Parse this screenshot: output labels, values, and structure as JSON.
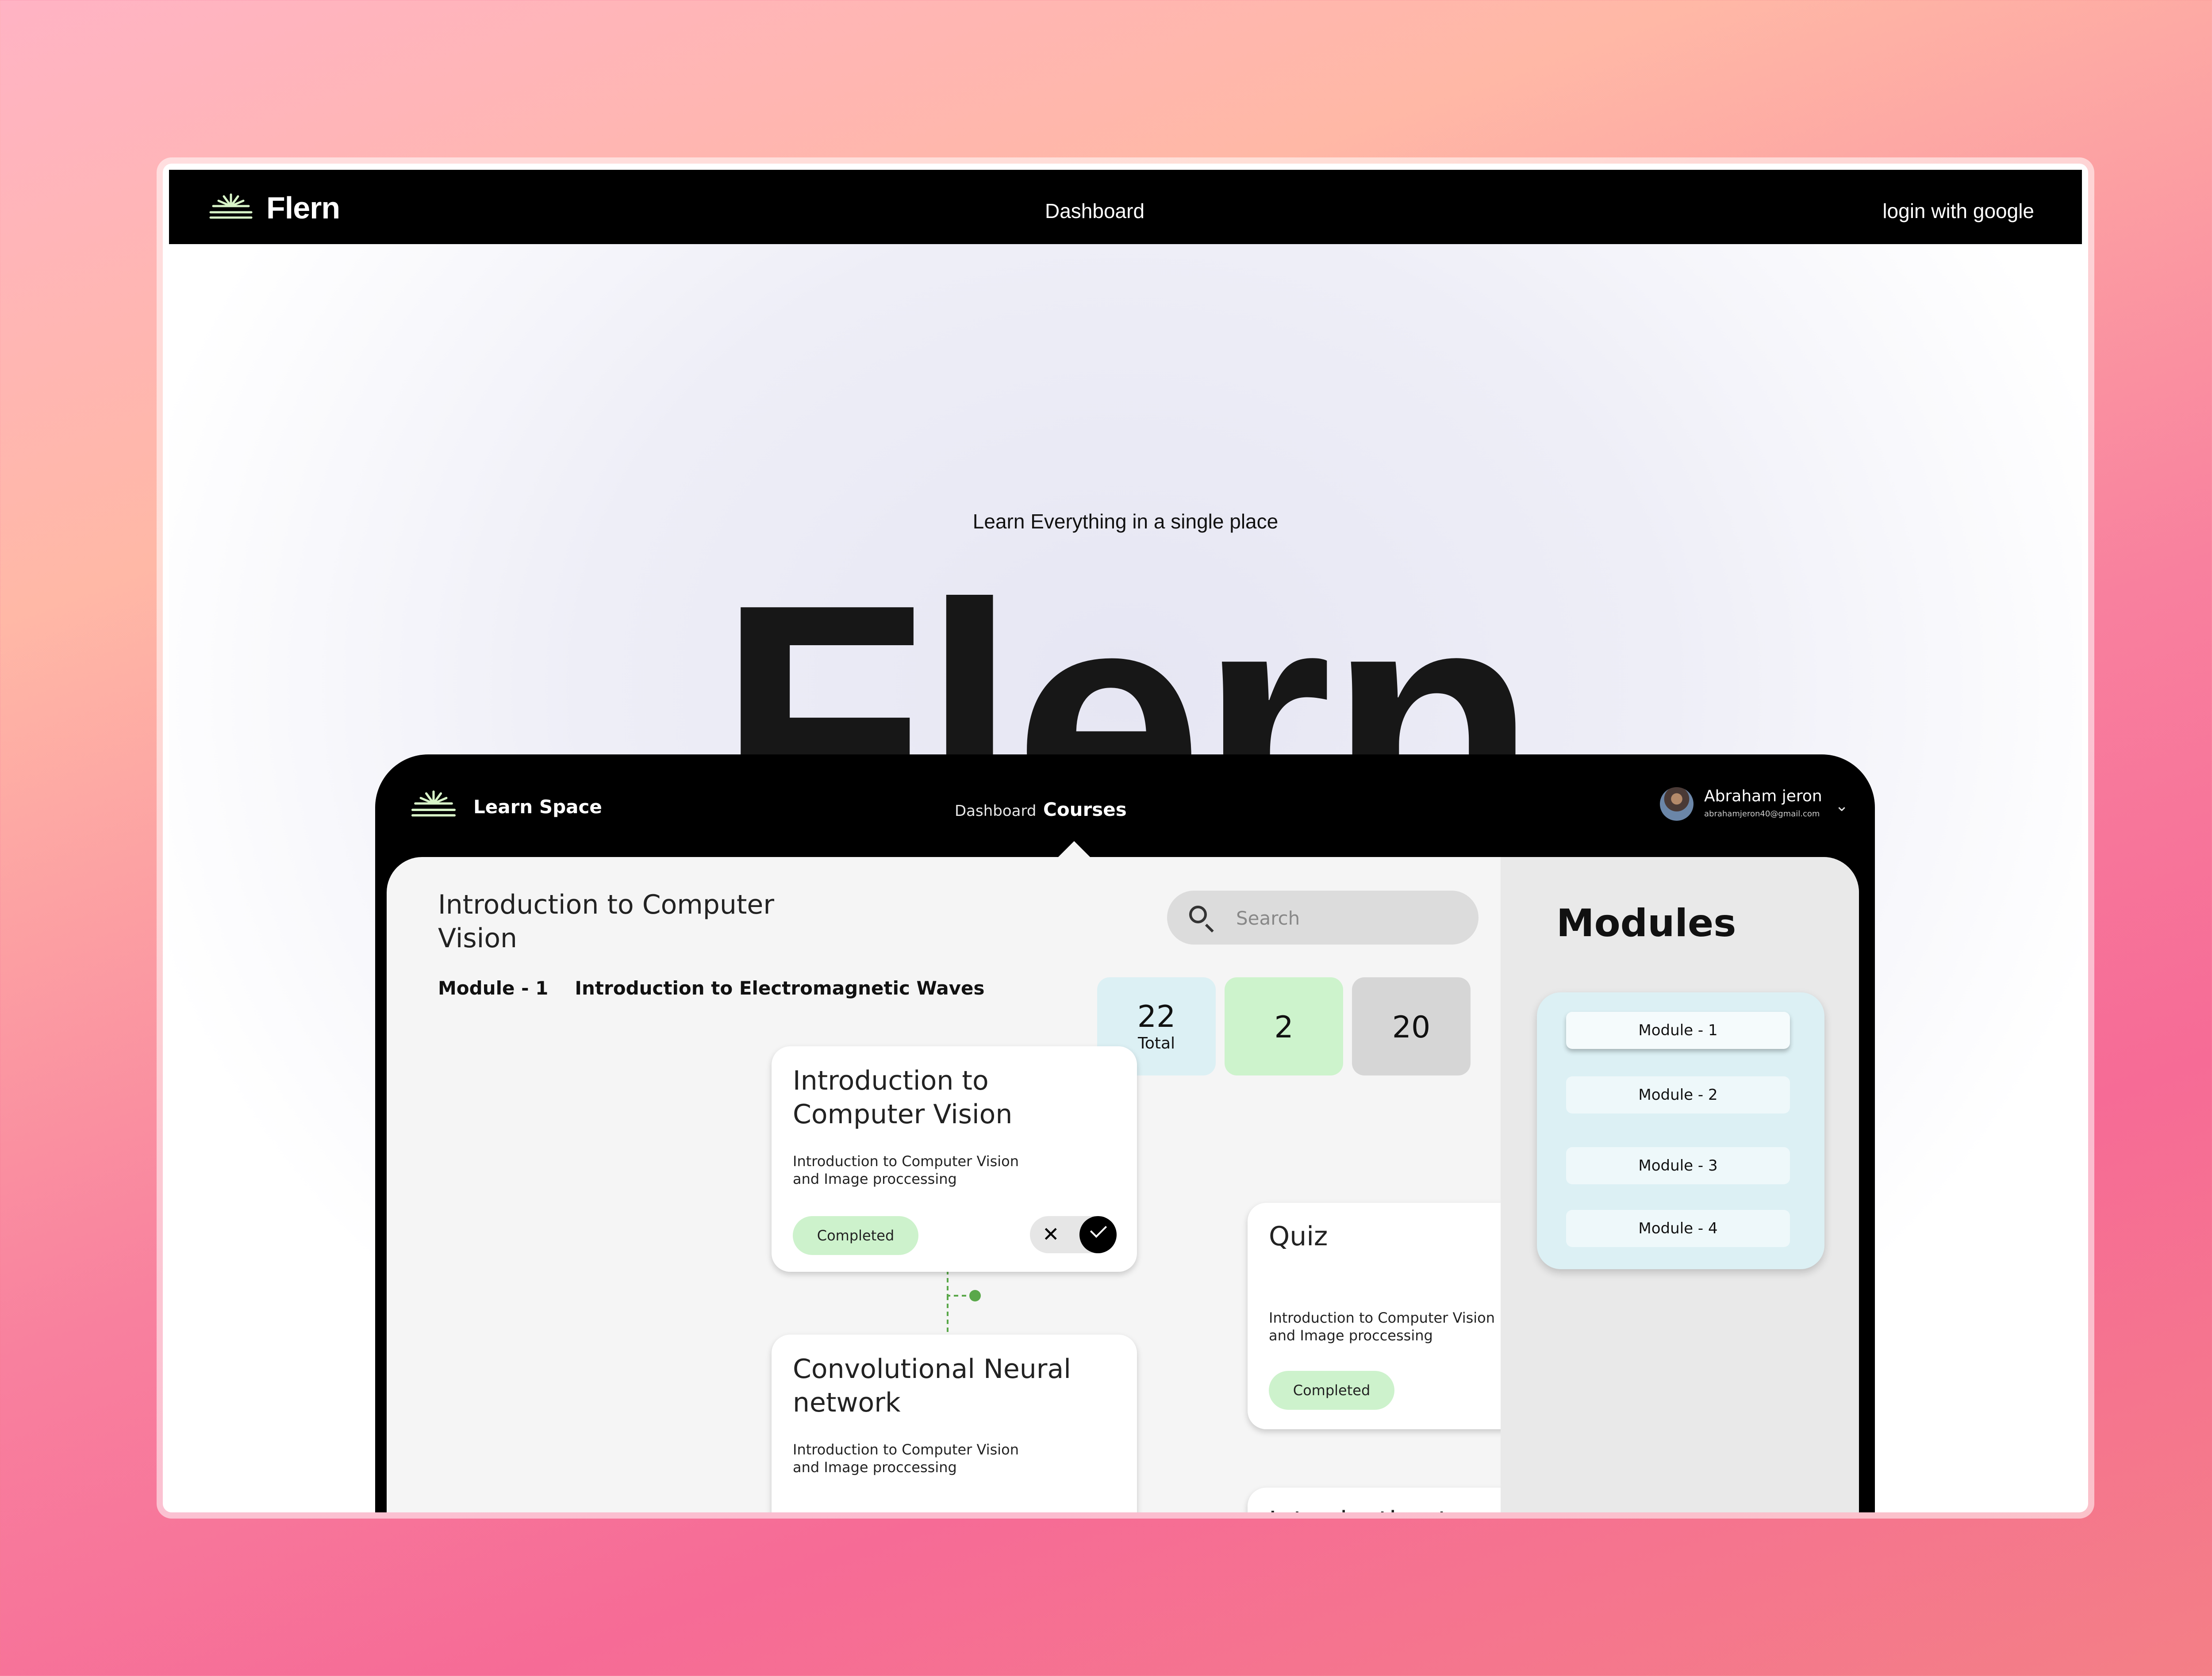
{
  "site": {
    "brand": "Flern",
    "nav_center": "Dashboard",
    "login": "login with google",
    "tagline": "Learn Everything in a single place",
    "hero_word": "Flern"
  },
  "app": {
    "brand": "Learn Space",
    "nav": [
      "Dashboard",
      "Courses"
    ],
    "user": {
      "name": "Abraham jeron",
      "email": "abrahamjeron40@gmail.com"
    }
  },
  "course": {
    "title": "Introduction to Computer Vision",
    "module_number": "Module  - 1",
    "module_name": "Introduction to Electromagnetic Waves",
    "search_placeholder": "Search",
    "stats": [
      {
        "value": "22",
        "label": "Total"
      },
      {
        "value": "2",
        "label": ""
      },
      {
        "value": "20",
        "label": ""
      }
    ]
  },
  "cards": [
    {
      "title": "Introduction to Computer Vision",
      "desc": "Introduction to Computer Vision and Image proccessing",
      "status": "Completed"
    },
    {
      "title": "Convolutional Neural network",
      "desc": "Introduction to Computer Vision and Image proccessing",
      "status": ""
    },
    {
      "title": "Quiz",
      "desc": "Introduction to Computer Vision and Image proccessing",
      "status": "Completed"
    },
    {
      "title": "Introduction to Computer Vision",
      "desc": "",
      "status": ""
    }
  ],
  "modules": {
    "title": "Modules",
    "items": [
      "Module - 1",
      "Module - 2",
      "Module - 3",
      "Module - 4"
    ]
  },
  "colors": {
    "accent_green": "#cdf2cc",
    "connector_green": "#5aa84a",
    "module_bg": "#dcf0f4"
  }
}
